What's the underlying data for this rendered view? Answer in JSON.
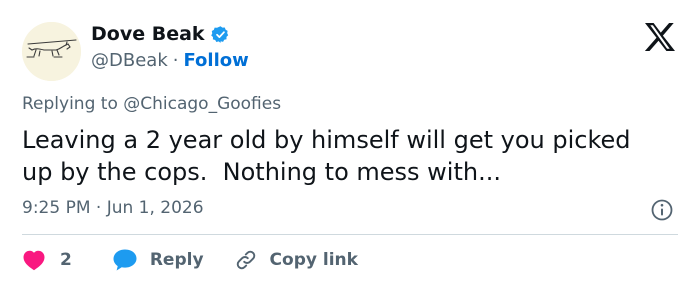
{
  "author": {
    "display_name": "Dove Beak",
    "handle": "@DBeak",
    "separator": "·",
    "follow_label": "Follow"
  },
  "reply_context": {
    "prefix": "Replying to ",
    "mention": "@Chicago_Goofies"
  },
  "tweet": {
    "text": "Leaving a 2 year old by himself will get you picked\nup by the cops.  Nothing to mess with...",
    "timestamp": "9:25 PM · Jun 1, 2026"
  },
  "actions": {
    "like_count": "2",
    "reply_label": "Reply",
    "copy_link_label": "Copy link"
  },
  "colors": {
    "like": "#f91880",
    "reply": "#1d9bf0",
    "follow": "#006fd6",
    "verified": "#1d9bf0",
    "muted": "#536471"
  },
  "icons": {
    "avatar": "dog-sketch-avatar",
    "verified": "verified-badge-icon",
    "brand": "x-logo-icon",
    "info": "info-icon",
    "like": "heart-icon",
    "reply": "speech-bubble-icon",
    "copy": "link-icon"
  }
}
